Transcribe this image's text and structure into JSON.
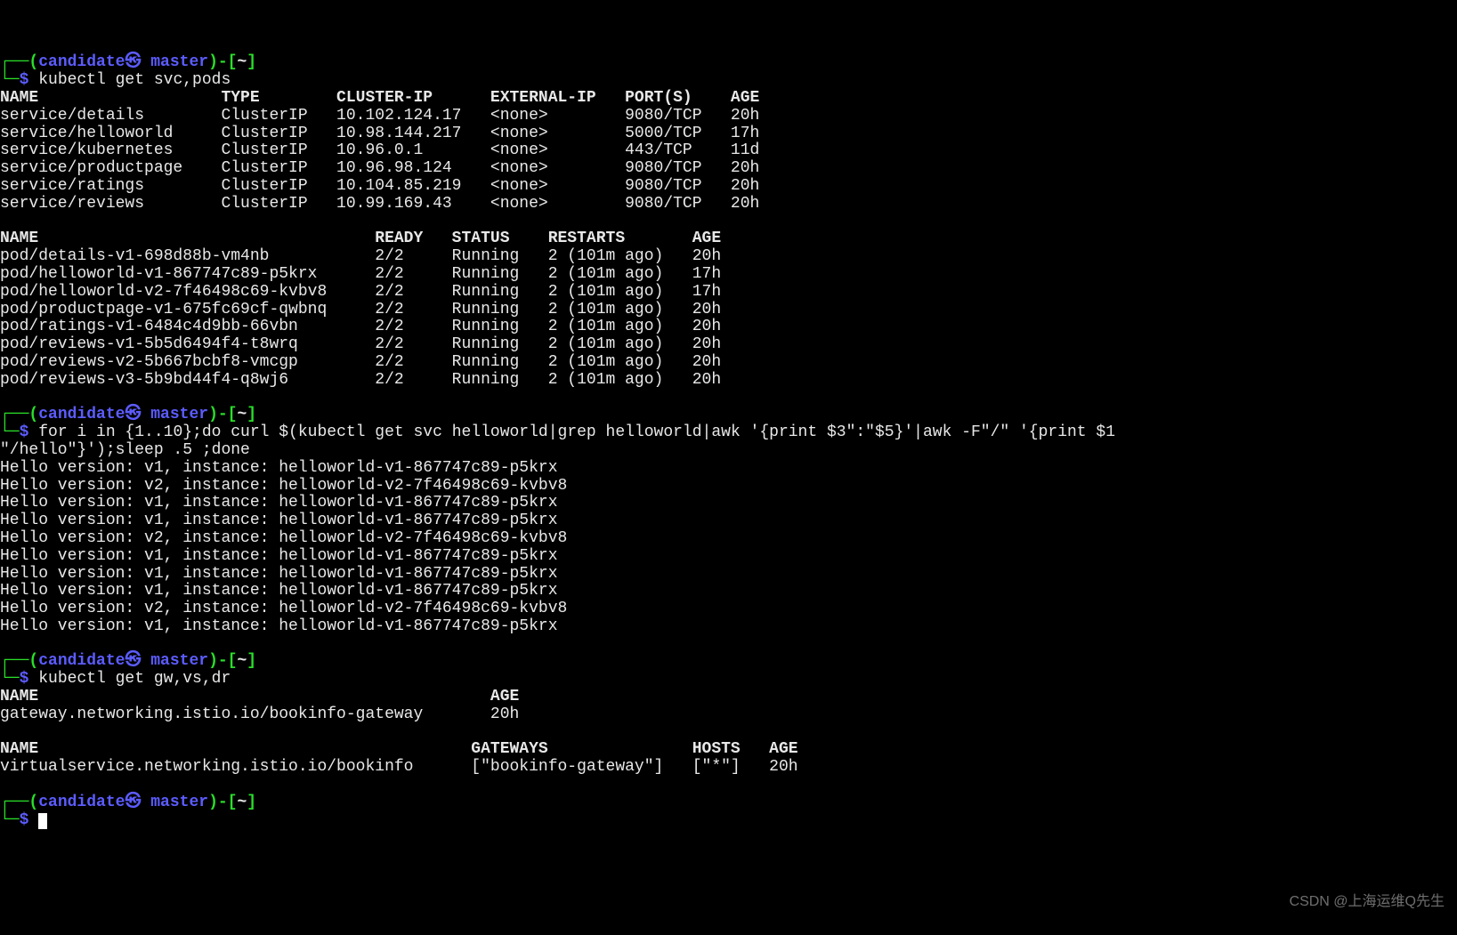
{
  "prompt": {
    "branch_open": "(",
    "user": "candidate",
    "swirl": "㉿",
    "host": " master",
    "branch_close": ")",
    "sep_open": "-[",
    "path": "~",
    "sep_close": "]",
    "corner_top": "┌──",
    "corner_bot": "└─",
    "dollar": "$ "
  },
  "cmd1": "kubectl get svc,pods",
  "svc_header": "NAME                   TYPE        CLUSTER-IP      EXTERNAL-IP   PORT(S)    AGE",
  "svc_rows": [
    "service/details        ClusterIP   10.102.124.17   <none>        9080/TCP   20h",
    "service/helloworld     ClusterIP   10.98.144.217   <none>        5000/TCP   17h",
    "service/kubernetes     ClusterIP   10.96.0.1       <none>        443/TCP    11d",
    "service/productpage    ClusterIP   10.96.98.124    <none>        9080/TCP   20h",
    "service/ratings        ClusterIP   10.104.85.219   <none>        9080/TCP   20h",
    "service/reviews        ClusterIP   10.99.169.43    <none>        9080/TCP   20h"
  ],
  "pod_header": "NAME                                   READY   STATUS    RESTARTS       AGE",
  "pod_rows": [
    "pod/details-v1-698d88b-vm4nb           2/2     Running   2 (101m ago)   20h",
    "pod/helloworld-v1-867747c89-p5krx      2/2     Running   2 (101m ago)   17h",
    "pod/helloworld-v2-7f46498c69-kvbv8     2/2     Running   2 (101m ago)   17h",
    "pod/productpage-v1-675fc69cf-qwbnq     2/2     Running   2 (101m ago)   20h",
    "pod/ratings-v1-6484c4d9bb-66vbn        2/2     Running   2 (101m ago)   20h",
    "pod/reviews-v1-5b5d6494f4-t8wrq        2/2     Running   2 (101m ago)   20h",
    "pod/reviews-v2-5b667bcbf8-vmcgp        2/2     Running   2 (101m ago)   20h",
    "pod/reviews-v3-5b9bd44f4-q8wj6         2/2     Running   2 (101m ago)   20h"
  ],
  "cmd2_l1": "for i in {1..10};do curl $(kubectl get svc helloworld|grep helloworld|awk '{print $3\":\"$5}'|awk -F\"/\" '{print $1",
  "cmd2_l2": "\"/hello\"}');sleep .5 ;done",
  "hello_rows": [
    "Hello version: v1, instance: helloworld-v1-867747c89-p5krx",
    "Hello version: v2, instance: helloworld-v2-7f46498c69-kvbv8",
    "Hello version: v1, instance: helloworld-v1-867747c89-p5krx",
    "Hello version: v1, instance: helloworld-v1-867747c89-p5krx",
    "Hello version: v2, instance: helloworld-v2-7f46498c69-kvbv8",
    "Hello version: v1, instance: helloworld-v1-867747c89-p5krx",
    "Hello version: v1, instance: helloworld-v1-867747c89-p5krx",
    "Hello version: v1, instance: helloworld-v1-867747c89-p5krx",
    "Hello version: v2, instance: helloworld-v2-7f46498c69-kvbv8",
    "Hello version: v1, instance: helloworld-v1-867747c89-p5krx"
  ],
  "cmd3": "kubectl get gw,vs,dr",
  "gw_header": "NAME                                               AGE",
  "gw_rows": [
    "gateway.networking.istio.io/bookinfo-gateway       20h"
  ],
  "vs_header": "NAME                                             GATEWAYS               HOSTS   AGE",
  "vs_rows": [
    "virtualservice.networking.istio.io/bookinfo      [\"bookinfo-gateway\"]   [\"*\"]   20h"
  ],
  "watermark": "CSDN @上海运维Q先生"
}
